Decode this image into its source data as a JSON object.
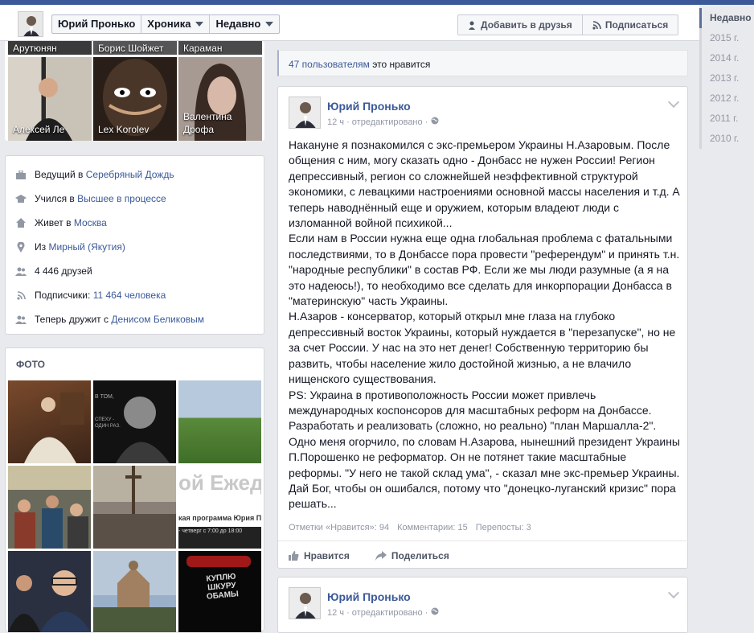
{
  "header": {
    "name": "Юрий Пронько",
    "chronicle": "Хроника",
    "recent": "Недавно",
    "add_friend": "Добавить в друзья",
    "subscribe": "Подписаться"
  },
  "years": [
    "Недавно",
    "2015 г.",
    "2014 г.",
    "2013 г.",
    "2012 г.",
    "2011 г.",
    "2010 г."
  ],
  "friends_top": [
    "Арутюнян",
    "Борис Шойжет",
    "Караман"
  ],
  "friends": [
    {
      "name": "Алексей Ле"
    },
    {
      "name": "Lex Korolev"
    },
    {
      "name": "Валентина\nДрофа"
    }
  ],
  "about": {
    "work_prefix": "Ведущий в ",
    "work_link": "Серебряный Дождь",
    "study_prefix": "Учился в ",
    "study_link": "Высшее в процессе",
    "lives_prefix": "Живет в ",
    "lives_link": "Москва",
    "from_prefix": "Из ",
    "from_link": "Мирный (Якутия)",
    "friends_count": "4 446 друзей",
    "followers_prefix": "Подписчики: ",
    "followers_link": "11 464 человека",
    "now_friends_prefix": "Теперь дружит с ",
    "now_friends_link": "Денисом Беликовым"
  },
  "photos": {
    "title": "ФОТО",
    "caption_1": "ой Ежедн",
    "caption_2": "кая программа Юрия Пр",
    "caption_3": "- четверг с 7:00 до 18:00",
    "caption_4": "КУПЛЮ\nШКУРУ\nОБАМЫ"
  },
  "likes_bar": {
    "link": "47 пользователям",
    "rest": " это нравится"
  },
  "post1": {
    "author": "Юрий Пронько",
    "meta": "12 ч · отредактировано ·",
    "paragraphs": [
      "Накануне я познакомился с экс-премьером Украины Н.Азаровым. После общения с ним, могу сказать одно - Донбасс не нужен России! Регион депрессивный, регион со сложнейшей неэффективной структурой экономики, с левацкими настроениями основной массы населения и т.д. А теперь наводнённый еще и оружием, которым владеют люди с изломанной войной психикой...",
      "Если нам в России нужна еще одна глобальная проблема с фатальными последствиями, то в Донбассе пора провести \"референдум\" и принять т.н. \"народные республики\" в состав РФ. Если же мы люди разумные (а я на это надеюсь!), то необходимо все сделать для инкорпорации Донбасса в \"материнскую\" часть Украины.",
      "Н.Азаров - консерватор, который открыл мне глаза на глубоко депрессивный восток Украины, который нуждается в \"перезапуске\", но не за счет России. У нас на это нет денег! Собственную территорию бы развить, чтобы население жило достойной жизнью, а не влачило нищенского существования.",
      "PS: Украина в противоположность России может привлечь международных коспонсоров для масштабных реформ на Донбассе. Разработать и реализовать (сложно, но реально) \"план Маршалла-2\". Одно меня огорчило, по словам Н.Азарова, нынешний президент Украины П.Порошенко не реформатор. Он не потянет такие масштабные реформы. \"У него не такой склад ума\", - сказал мне экс-премьер Украины. Дай Бог, чтобы он ошибался, потому что \"донецко-луганский кризис\" пора решать..."
    ],
    "likes": "Отметки «Нравится»: 94",
    "comments": "Комментарии: 15",
    "shares": "Перепосты: 3",
    "like_action": "Нравится",
    "share_action": "Поделиться"
  },
  "post2": {
    "author": "Юрий Пронько",
    "meta": "12 ч · отредактировано ·"
  }
}
